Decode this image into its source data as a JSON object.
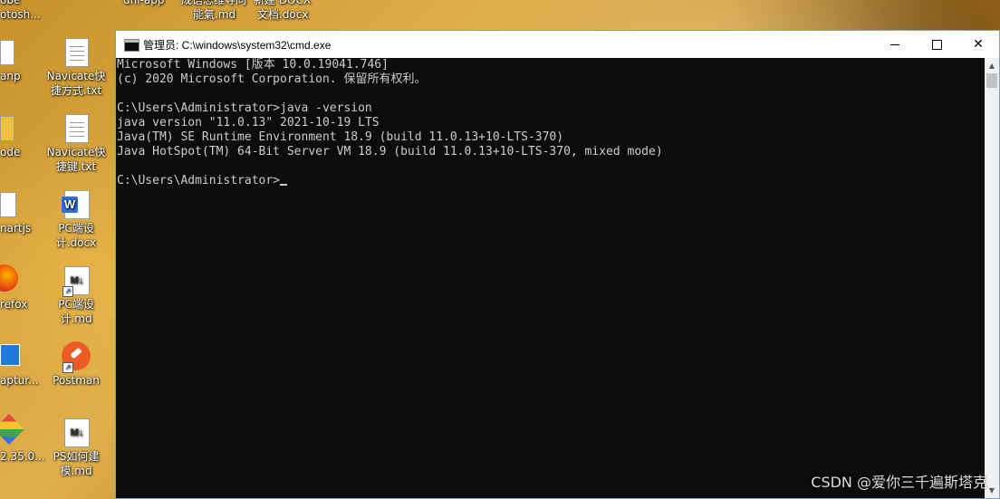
{
  "desktop": {
    "top_partial_labels": [
      "obe",
      "otosh...",
      "uni-app",
      "成语思维导向",
      "新建 DOCX",
      "能氣.md",
      "文档.docx"
    ],
    "left_partial_labels": [
      "anp",
      "ode",
      "nartjs",
      "refox",
      "aptur...",
      "2.35.0..."
    ],
    "icons": [
      {
        "label": "Navicate快捷方式.txt",
        "icon": "text-file-icon"
      },
      {
        "label": "Navicate快捷键.txt",
        "icon": "text-file-icon"
      },
      {
        "label": "PC端设计.docx",
        "icon": "word-doc-icon"
      },
      {
        "label": "PC端设计.md",
        "icon": "markdown-file-icon",
        "badge": "M↓"
      },
      {
        "label": "Postman",
        "icon": "postman-icon"
      },
      {
        "label": "PS如何建模.md",
        "icon": "markdown-file-icon",
        "badge": "M↓"
      }
    ]
  },
  "window": {
    "title": "管理员: C:\\windows\\system32\\cmd.exe",
    "minimize_glyph": "—",
    "close_glyph": "✕"
  },
  "console": {
    "lines": [
      "Microsoft Windows [版本 10.0.19041.746]",
      "(c) 2020 Microsoft Corporation. 保留所有权利。",
      "",
      "C:\\Users\\Administrator>java -version",
      "java version \"11.0.13\" 2021-10-19 LTS",
      "Java(TM) SE Runtime Environment 18.9 (build 11.0.13+10-LTS-370)",
      "Java HotSpot(TM) 64-Bit Server VM 18.9 (build 11.0.13+10-LTS-370, mixed mode)",
      "",
      "C:\\Users\\Administrator>"
    ],
    "text_color": "#cccccc",
    "background": "#0c0c0c"
  },
  "watermark": "CSDN @爱你三千遍斯塔克"
}
